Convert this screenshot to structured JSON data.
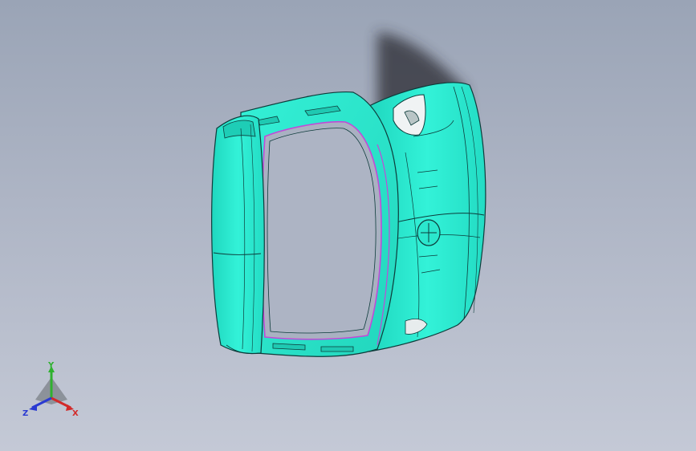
{
  "viewport": {
    "background_top": "#9aa4b6",
    "background_bottom": "#c4c9d6"
  },
  "model": {
    "body_color": "#2ff0d6",
    "edge_color": "#0d3b3a",
    "highlight_color": "#c14ad8",
    "shadow_color": "#2a2c33"
  },
  "triad": {
    "x_label": "X",
    "y_label": "Y",
    "z_label": "Z",
    "x_color": "#d22a2a",
    "y_color": "#2fb12f",
    "z_color": "#2a3ad2"
  }
}
